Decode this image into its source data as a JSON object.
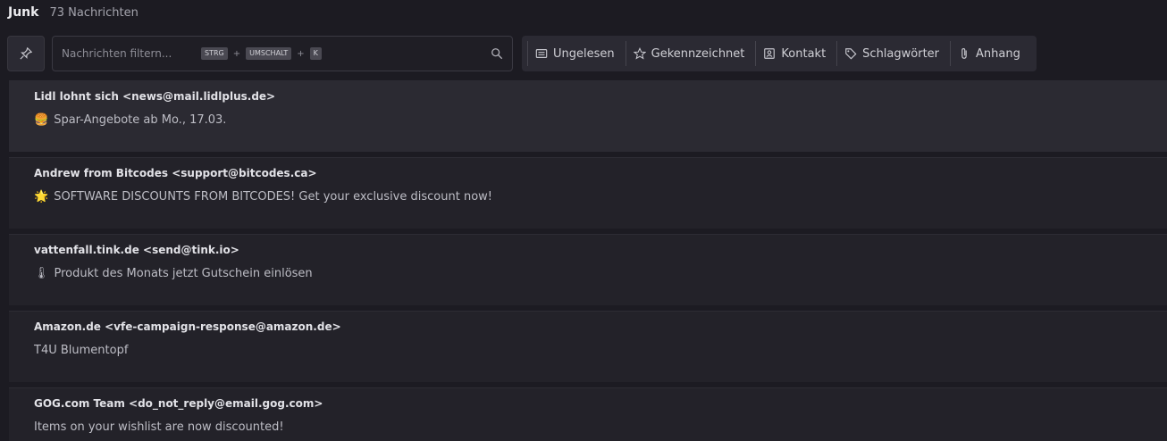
{
  "header": {
    "folder": "Junk",
    "count": "73 Nachrichten"
  },
  "search": {
    "placeholder": "Nachrichten filtern...",
    "chips": [
      "STRG",
      "UMSCHALT",
      "K"
    ],
    "chip_sep": "+"
  },
  "filters": [
    {
      "label": "Ungelesen",
      "icon": "envelope-icon"
    },
    {
      "label": "Gekennzeichnet",
      "icon": "star-icon"
    },
    {
      "label": "Kontakt",
      "icon": "contact-card-icon"
    },
    {
      "label": "Schlagwörter",
      "icon": "tag-icon"
    },
    {
      "label": "Anhang",
      "icon": "paperclip-icon"
    }
  ],
  "messages": [
    {
      "sender": "Lidl lohnt sich <news@mail.lidlplus.de>",
      "emoji": "🍔",
      "subject": "Spar-Angebote ab Mo., 17.03."
    },
    {
      "sender": "Andrew from Bitcodes <support@bitcodes.ca>",
      "emoji": "🌟",
      "subject": "SOFTWARE DISCOUNTS FROM BITCODES! Get your exclusive discount now!"
    },
    {
      "sender": "vattenfall.tink.de <send@tink.io>",
      "emoji": "🌡",
      "subject": "Produkt des Monats jetzt Gutschein einlösen"
    },
    {
      "sender": "Amazon.de <vfe-campaign-response@amazon.de>",
      "emoji": "",
      "subject": "T4U Blumentopf"
    },
    {
      "sender": "GOG.com Team <do_not_reply@email.gog.com>",
      "emoji": "",
      "subject": "Items on your wishlist are now discounted!"
    }
  ]
}
